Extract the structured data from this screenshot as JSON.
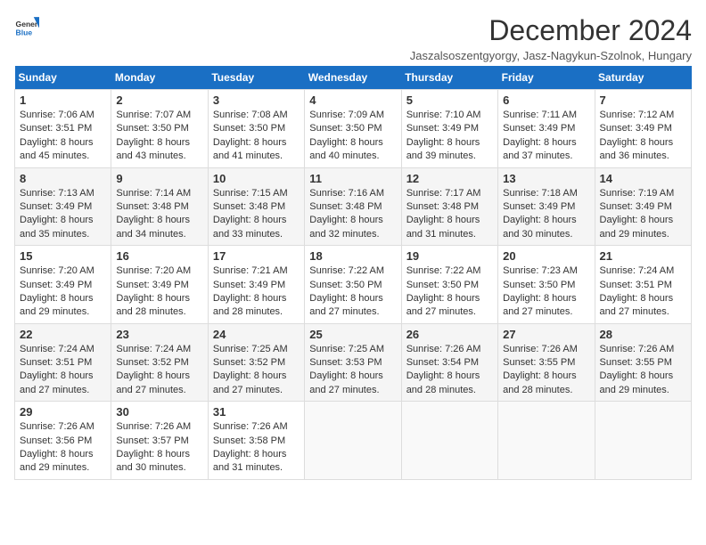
{
  "logo": {
    "line1": "General",
    "line2": "Blue"
  },
  "title": "December 2024",
  "subtitle": "Jaszalsoszentgyorgy, Jasz-Nagykun-Szolnok, Hungary",
  "days_of_week": [
    "Sunday",
    "Monday",
    "Tuesday",
    "Wednesday",
    "Thursday",
    "Friday",
    "Saturday"
  ],
  "weeks": [
    [
      {
        "day": 1,
        "sunrise": "7:06 AM",
        "sunset": "3:51 PM",
        "daylight": "8 hours and 45 minutes."
      },
      {
        "day": 2,
        "sunrise": "7:07 AM",
        "sunset": "3:50 PM",
        "daylight": "8 hours and 43 minutes."
      },
      {
        "day": 3,
        "sunrise": "7:08 AM",
        "sunset": "3:50 PM",
        "daylight": "8 hours and 41 minutes."
      },
      {
        "day": 4,
        "sunrise": "7:09 AM",
        "sunset": "3:50 PM",
        "daylight": "8 hours and 40 minutes."
      },
      {
        "day": 5,
        "sunrise": "7:10 AM",
        "sunset": "3:49 PM",
        "daylight": "8 hours and 39 minutes."
      },
      {
        "day": 6,
        "sunrise": "7:11 AM",
        "sunset": "3:49 PM",
        "daylight": "8 hours and 37 minutes."
      },
      {
        "day": 7,
        "sunrise": "7:12 AM",
        "sunset": "3:49 PM",
        "daylight": "8 hours and 36 minutes."
      }
    ],
    [
      {
        "day": 8,
        "sunrise": "7:13 AM",
        "sunset": "3:49 PM",
        "daylight": "8 hours and 35 minutes."
      },
      {
        "day": 9,
        "sunrise": "7:14 AM",
        "sunset": "3:48 PM",
        "daylight": "8 hours and 34 minutes."
      },
      {
        "day": 10,
        "sunrise": "7:15 AM",
        "sunset": "3:48 PM",
        "daylight": "8 hours and 33 minutes."
      },
      {
        "day": 11,
        "sunrise": "7:16 AM",
        "sunset": "3:48 PM",
        "daylight": "8 hours and 32 minutes."
      },
      {
        "day": 12,
        "sunrise": "7:17 AM",
        "sunset": "3:48 PM",
        "daylight": "8 hours and 31 minutes."
      },
      {
        "day": 13,
        "sunrise": "7:18 AM",
        "sunset": "3:49 PM",
        "daylight": "8 hours and 30 minutes."
      },
      {
        "day": 14,
        "sunrise": "7:19 AM",
        "sunset": "3:49 PM",
        "daylight": "8 hours and 29 minutes."
      }
    ],
    [
      {
        "day": 15,
        "sunrise": "7:20 AM",
        "sunset": "3:49 PM",
        "daylight": "8 hours and 29 minutes."
      },
      {
        "day": 16,
        "sunrise": "7:20 AM",
        "sunset": "3:49 PM",
        "daylight": "8 hours and 28 minutes."
      },
      {
        "day": 17,
        "sunrise": "7:21 AM",
        "sunset": "3:49 PM",
        "daylight": "8 hours and 28 minutes."
      },
      {
        "day": 18,
        "sunrise": "7:22 AM",
        "sunset": "3:50 PM",
        "daylight": "8 hours and 27 minutes."
      },
      {
        "day": 19,
        "sunrise": "7:22 AM",
        "sunset": "3:50 PM",
        "daylight": "8 hours and 27 minutes."
      },
      {
        "day": 20,
        "sunrise": "7:23 AM",
        "sunset": "3:50 PM",
        "daylight": "8 hours and 27 minutes."
      },
      {
        "day": 21,
        "sunrise": "7:24 AM",
        "sunset": "3:51 PM",
        "daylight": "8 hours and 27 minutes."
      }
    ],
    [
      {
        "day": 22,
        "sunrise": "7:24 AM",
        "sunset": "3:51 PM",
        "daylight": "8 hours and 27 minutes."
      },
      {
        "day": 23,
        "sunrise": "7:24 AM",
        "sunset": "3:52 PM",
        "daylight": "8 hours and 27 minutes."
      },
      {
        "day": 24,
        "sunrise": "7:25 AM",
        "sunset": "3:52 PM",
        "daylight": "8 hours and 27 minutes."
      },
      {
        "day": 25,
        "sunrise": "7:25 AM",
        "sunset": "3:53 PM",
        "daylight": "8 hours and 27 minutes."
      },
      {
        "day": 26,
        "sunrise": "7:26 AM",
        "sunset": "3:54 PM",
        "daylight": "8 hours and 28 minutes."
      },
      {
        "day": 27,
        "sunrise": "7:26 AM",
        "sunset": "3:55 PM",
        "daylight": "8 hours and 28 minutes."
      },
      {
        "day": 28,
        "sunrise": "7:26 AM",
        "sunset": "3:55 PM",
        "daylight": "8 hours and 29 minutes."
      }
    ],
    [
      {
        "day": 29,
        "sunrise": "7:26 AM",
        "sunset": "3:56 PM",
        "daylight": "8 hours and 29 minutes."
      },
      {
        "day": 30,
        "sunrise": "7:26 AM",
        "sunset": "3:57 PM",
        "daylight": "8 hours and 30 minutes."
      },
      {
        "day": 31,
        "sunrise": "7:26 AM",
        "sunset": "3:58 PM",
        "daylight": "8 hours and 31 minutes."
      },
      null,
      null,
      null,
      null
    ]
  ]
}
